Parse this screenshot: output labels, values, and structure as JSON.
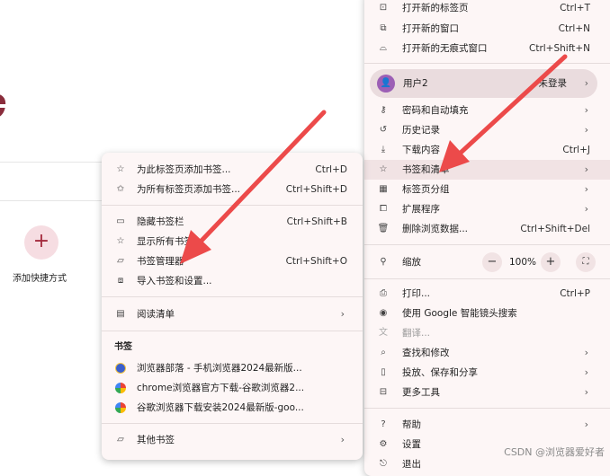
{
  "newtab": {
    "shortcut_add_symbol": "+",
    "shortcut_label": "添加快捷方式"
  },
  "main_menu": {
    "items_top": [
      {
        "icon": "new-tab-icon",
        "label": "打开新的标签页",
        "shortcut": "Ctrl+T"
      },
      {
        "icon": "new-window-icon",
        "label": "打开新的窗口",
        "shortcut": "Ctrl+N"
      },
      {
        "icon": "incognito-icon",
        "label": "打开新的无痕式窗口",
        "shortcut": "Ctrl+Shift+N"
      }
    ],
    "profile": {
      "name": "用户2",
      "status": "未登录",
      "arrow": "›"
    },
    "items_mid": [
      {
        "label": "密码和自动填充",
        "arrow": "›"
      },
      {
        "label": "历史记录",
        "arrow": "›"
      },
      {
        "label": "下载内容",
        "shortcut": "Ctrl+J"
      },
      {
        "label": "书签和清单",
        "arrow": "›"
      },
      {
        "label": "标签页分组",
        "arrow": "›"
      },
      {
        "label": "扩展程序",
        "arrow": "›"
      },
      {
        "label": "删除浏览数据...",
        "shortcut": "Ctrl+Shift+Del"
      }
    ],
    "zoom": {
      "label": "缩放",
      "minus": "−",
      "value": "100%",
      "plus": "+"
    },
    "items_low": [
      {
        "label": "打印...",
        "shortcut": "Ctrl+P"
      },
      {
        "label": "使用 Google 智能镜头搜索"
      },
      {
        "label": "翻译..."
      },
      {
        "label": "查找和修改",
        "arrow": "›"
      },
      {
        "label": "投放、保存和分享",
        "arrow": "›"
      },
      {
        "label": "更多工具",
        "arrow": "›"
      }
    ],
    "items_bottom": [
      {
        "label": "帮助",
        "arrow": "›"
      },
      {
        "label": "设置"
      },
      {
        "label": "退出"
      }
    ]
  },
  "sub_menu": {
    "items_a": [
      {
        "label": "为此标签页添加书签...",
        "shortcut": "Ctrl+D"
      },
      {
        "label": "为所有标签页添加书签...",
        "shortcut": "Ctrl+Shift+D"
      }
    ],
    "items_b": [
      {
        "label": "隐藏书签栏",
        "shortcut": "Ctrl+Shift+B"
      },
      {
        "label": "显示所有书签"
      },
      {
        "label": "书签管理器",
        "shortcut": "Ctrl+Shift+O"
      },
      {
        "label": "导入书签和设置..."
      }
    ],
    "reading_list": {
      "label": "阅读清单",
      "arrow": "›"
    },
    "bookmarks_title": "书签",
    "bookmarks": [
      {
        "favicon": "browser-logo",
        "label": "浏览器部落 - 手机浏览器2024最新版..."
      },
      {
        "favicon": "google-logo",
        "label": "chrome浏览器官方下载-谷歌浏览器2..."
      },
      {
        "favicon": "google-logo",
        "label": "谷歌浏览器下载安装2024最新版-goo..."
      }
    ],
    "other_bookmarks": {
      "label": "其他书签",
      "arrow": "›"
    }
  },
  "colors": {
    "arrow": "#ec4a4a",
    "menu_bg": "#fdf6f6",
    "highlight": "#f1e3e4",
    "avatar": "#9c5fb5"
  },
  "watermark": "CSDN @浏览器爱好者"
}
